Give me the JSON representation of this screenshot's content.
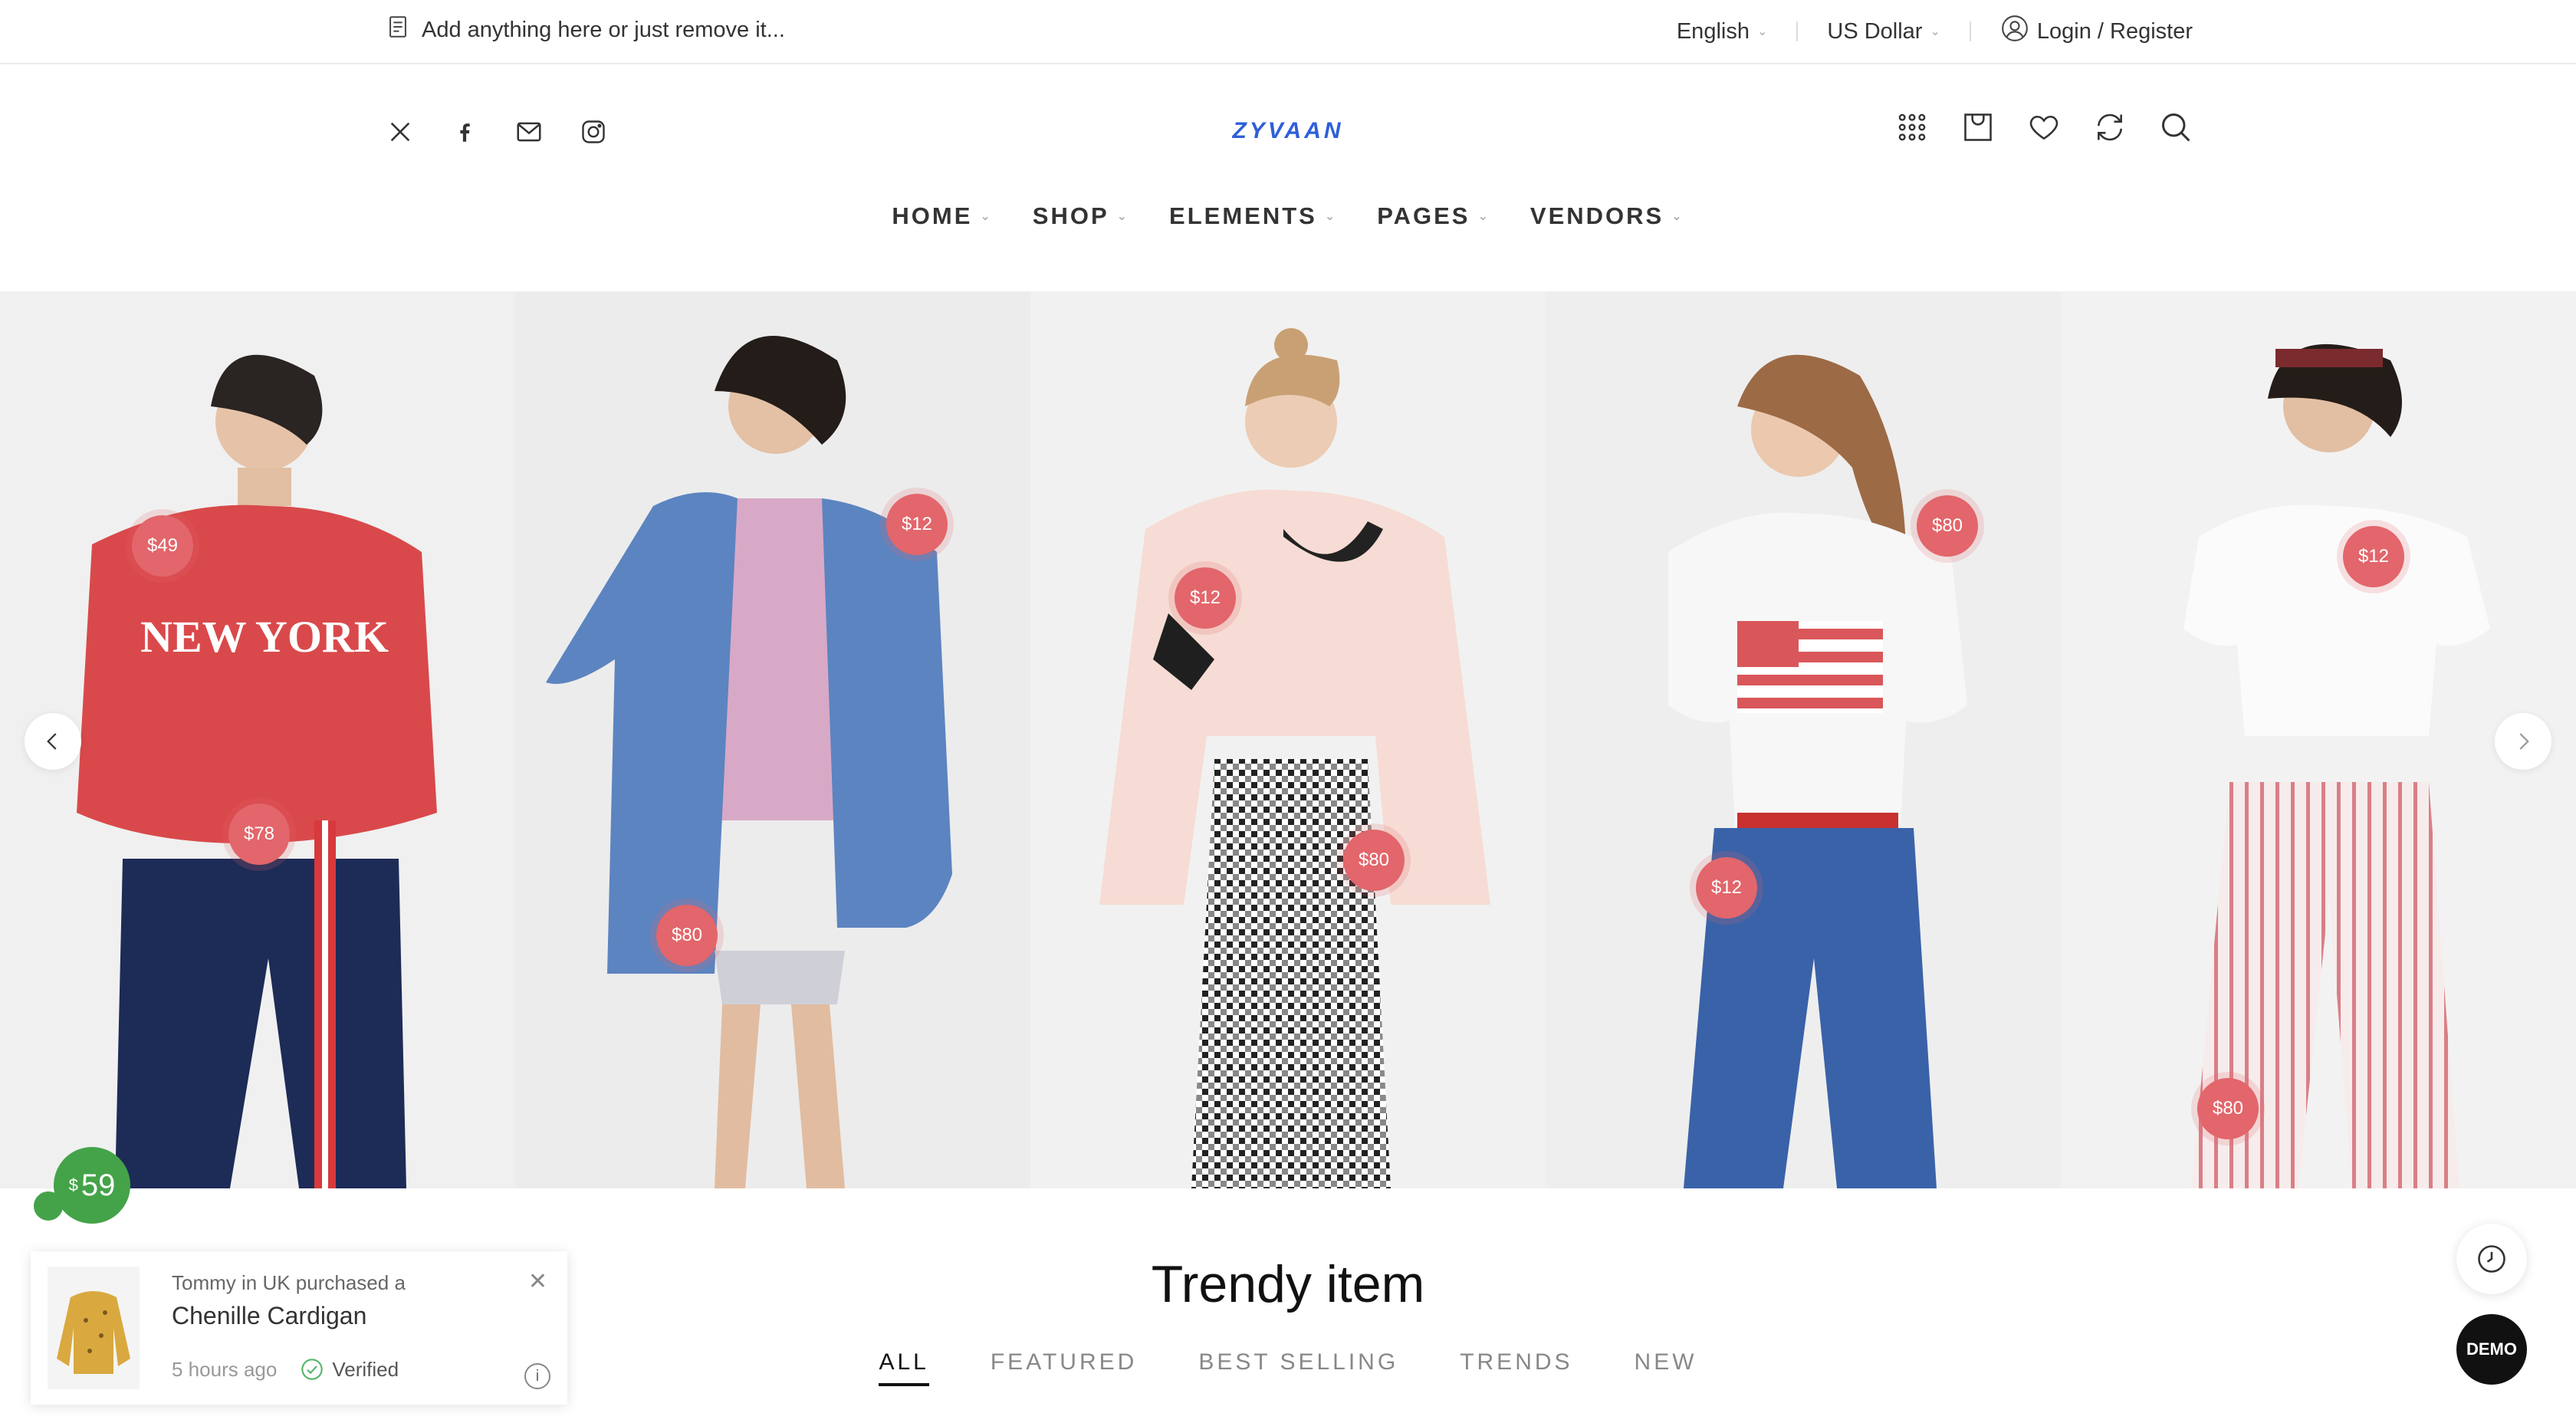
{
  "topbar": {
    "promo_text": "Add anything here or just remove it...",
    "language": "English",
    "currency": "US Dollar",
    "account_label": "Login / Register"
  },
  "header": {
    "logo": "ZYVAAN",
    "social_icons": [
      "x-twitter-icon",
      "facebook-icon",
      "mail-icon",
      "instagram-icon"
    ],
    "action_icons": [
      "grid-icon",
      "cart-icon",
      "heart-icon",
      "compare-icon",
      "search-icon"
    ]
  },
  "nav": {
    "items": [
      {
        "label": "HOME"
      },
      {
        "label": "SHOP"
      },
      {
        "label": "ELEMENTS"
      },
      {
        "label": "PAGES"
      },
      {
        "label": "VENDORS"
      }
    ]
  },
  "hero": {
    "panels": [
      {
        "hotspots": [
          "$49",
          "$78"
        ]
      },
      {
        "hotspots": [
          "$12",
          "$80"
        ]
      },
      {
        "hotspots": [
          "$12",
          "$80"
        ]
      },
      {
        "hotspots": [
          "$80",
          "$12"
        ]
      },
      {
        "hotspots": [
          "$12",
          "$80"
        ]
      }
    ]
  },
  "section": {
    "title": "Trendy item",
    "tabs": [
      {
        "label": "ALL",
        "active": true
      },
      {
        "label": "FEATURED"
      },
      {
        "label": "BEST SELLING"
      },
      {
        "label": "TRENDS"
      },
      {
        "label": "NEW"
      }
    ]
  },
  "widgets": {
    "price_badge_currency": "$",
    "price_badge_value": "59",
    "toast": {
      "line1": "Tommy in UK purchased a",
      "product": "Chenille Cardigan",
      "time": "5 hours ago",
      "verified": "Verified"
    },
    "demo_label": "DEMO"
  },
  "colors": {
    "accent": "#e2666b",
    "logo": "#2e5fd9",
    "badge": "#44a349"
  }
}
